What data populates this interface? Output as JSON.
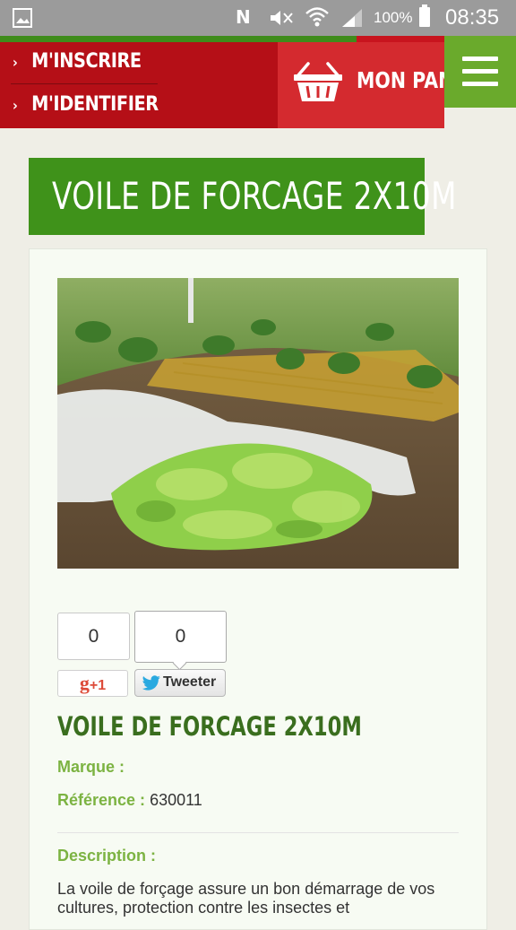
{
  "status_bar": {
    "battery": "100%",
    "time": "08:35",
    "icons": [
      "gallery-icon",
      "nfc-icon",
      "mute-icon",
      "wifi-icon",
      "signal-icon",
      "battery-icon"
    ]
  },
  "header": {
    "account_links": [
      "M'INSCRIRE",
      "M'IDENTIFIER"
    ],
    "cart_label": "MON PANIER",
    "colors": {
      "dark_red": "#b50f17",
      "red": "#d42a2f",
      "green": "#6aaa2c"
    }
  },
  "page": {
    "title": "VOILE DE FORCAGE 2X10M"
  },
  "product": {
    "image_alt": "cart-basket-icon",
    "social": {
      "gplus_count": "0",
      "tweet_count": "0",
      "gplus_label": "+1",
      "tweet_label": "Tweeter"
    },
    "name": "VOILE DE FORCAGE 2X10M",
    "marque_label": "Marque :",
    "marque_value": "",
    "reference_label": "Référence :",
    "reference_value": "630011",
    "description_label": "Description :",
    "description_text": "La voile de forçage assure un bon démarrage de vos cultures, protection contre les insectes et"
  }
}
